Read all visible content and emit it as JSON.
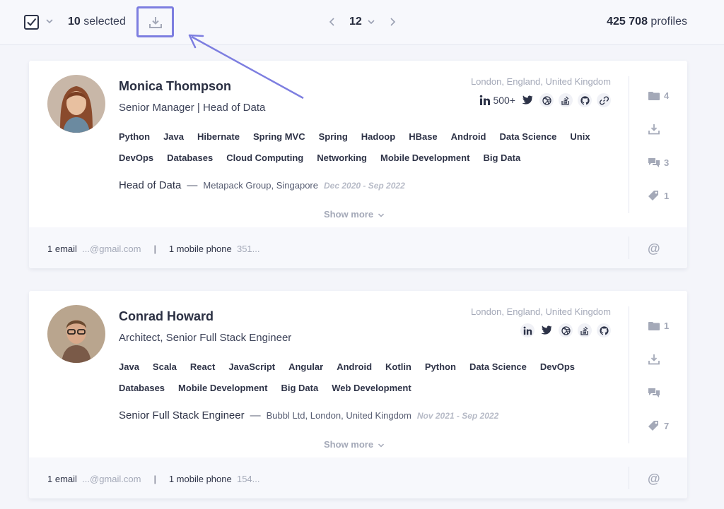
{
  "toolbar": {
    "selected_count": "10",
    "selected_label": "selected",
    "page": "12",
    "profiles_count": "425 708",
    "profiles_label": "profiles"
  },
  "icons": [
    "checkbox-icon",
    "chevron-down-icon",
    "download-icon",
    "chevron-left-icon",
    "chevron-right-icon",
    "linkedin-icon",
    "twitter-icon",
    "dribbble-icon",
    "stackoverflow-icon",
    "github-icon",
    "link-icon",
    "folder-icon",
    "comment-icon",
    "tag-icon",
    "at-icon"
  ],
  "colors": {
    "highlight": "#7d7ee0",
    "text": "#2d3348",
    "muted": "#a4a9b8"
  },
  "profiles": [
    {
      "name": "Monica Thompson",
      "title": "Senior Manager | Head of Data",
      "location": "London, England, United Kingdom",
      "linkedin_count": "500+",
      "skills": [
        "Python",
        "Java",
        "Hibernate",
        "Spring MVC",
        "Spring",
        "Hadoop",
        "HBase",
        "Android",
        "Data Science",
        "Unix",
        "DevOps",
        "Databases",
        "Cloud Computing",
        "Networking",
        "Mobile Development",
        "Big Data"
      ],
      "job_title": "Head of Data",
      "company": "Metapack Group, Singapore",
      "dates": "Dec 2020 - Sep 2022",
      "show_more": "Show more",
      "folders": "4",
      "comments": "3",
      "tags": "1",
      "email_label": "1 email",
      "email_value": "...@gmail.com",
      "phone_label": "1 mobile phone",
      "phone_value": "351..."
    },
    {
      "name": "Conrad Howard",
      "title": "Architect, Senior Full Stack Engineer",
      "location": "London, England, United Kingdom",
      "skills": [
        "Java",
        "Scala",
        "React",
        "JavaScript",
        "Angular",
        "Android",
        "Kotlin",
        "Python",
        "Data Science",
        "DevOps",
        "Databases",
        "Mobile Development",
        "Big Data",
        "Web Development"
      ],
      "job_title": "Senior Full Stack Engineer",
      "company": "Bubbl Ltd, London, United Kingdom",
      "dates": "Nov 2021 - Sep 2022",
      "show_more": "Show more",
      "folders": "1",
      "tags": "7",
      "email_label": "1 email",
      "email_value": "...@gmail.com",
      "phone_label": "1 mobile phone",
      "phone_value": "154..."
    }
  ]
}
